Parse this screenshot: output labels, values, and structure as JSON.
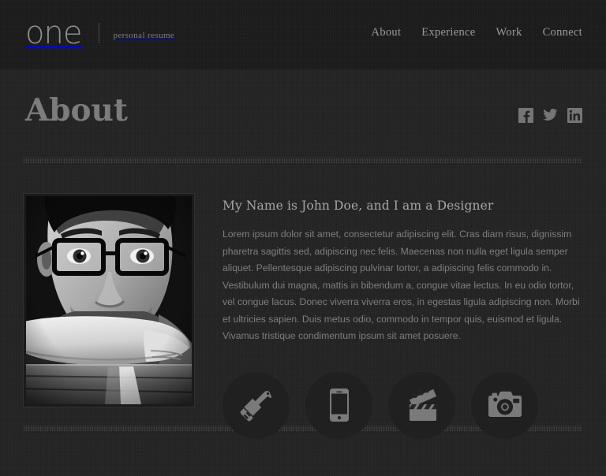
{
  "header": {
    "logo_text": "one",
    "tagline": "personal resume",
    "nav": [
      {
        "label": "About",
        "name": "nav-link-about"
      },
      {
        "label": "Experience",
        "name": "nav-link-experience"
      },
      {
        "label": "Work",
        "name": "nav-link-work"
      },
      {
        "label": "Connect",
        "name": "nav-link-connect"
      }
    ]
  },
  "page": {
    "title": "About"
  },
  "social": [
    {
      "icon": "facebook-icon",
      "label": "Facebook"
    },
    {
      "icon": "twitter-icon",
      "label": "Twitter"
    },
    {
      "icon": "linkedin-icon",
      "label": "LinkedIn"
    }
  ],
  "about": {
    "photo_alt": "Black and white portrait of a man wearing glasses resting on a wooden table",
    "heading": "My Name is John Doe, and I am a Designer",
    "body": "Lorem ipsum dolor sit amet, consectetur adipiscing elit. Cras diam risus, dignissim pharetra sagittis sed, adipiscing nec felis. Maecenas non nulla eget ligula semper aliquet. Pellentesque adipiscing pulvinar tortor, a adipiscing felis commodo in. Vestibulum dui magna, mattis in bibendum a, congue vitae lectus. In eu odio tortor, vel congue lacus. Donec viverra viverra eros, in egestas ligula adipiscing non. Morbi et ultricies sapien. Duis metus odio, commodo in tempor quis, euismod et ligula. Vivamus tristique condimentum ipsum sit amet posuere."
  },
  "services": [
    {
      "icon": "paintbrush-icon",
      "label": "Design"
    },
    {
      "icon": "smartphone-icon",
      "label": "Mobile"
    },
    {
      "icon": "clapperboard-icon",
      "label": "Video"
    },
    {
      "icon": "camera-icon",
      "label": "Photography"
    }
  ],
  "colors": {
    "page_background": "#262626",
    "header_background": "#1e1e1e",
    "title_text": "#7c7c7c",
    "body_text": "#7e7e7e",
    "heading_text": "#a6a6a6",
    "icon_fill": "#7a7a7a",
    "service_circle": "#202020"
  }
}
